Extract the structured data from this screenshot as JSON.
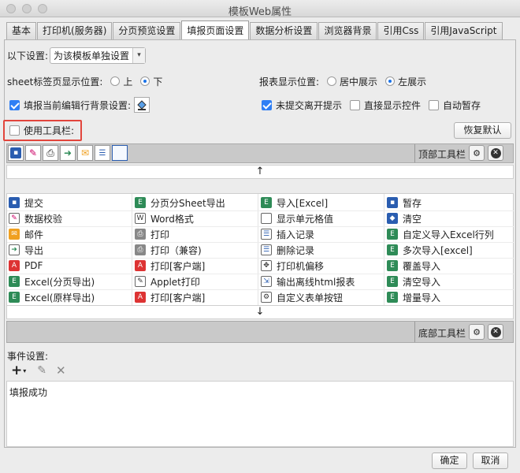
{
  "window": {
    "title": "模板Web属性"
  },
  "tabs": [
    "基本",
    "打印机(服务器)",
    "分页预览设置",
    "填报页面设置",
    "数据分析设置",
    "浏览器背景",
    "引用Css",
    "引用JavaScript"
  ],
  "settings": {
    "scope_label": "以下设置:",
    "scope_value": "为该模板单独设置",
    "sheet_pos_label": "sheet标签页显示位置:",
    "sheet_pos_top": "上",
    "sheet_pos_bottom": "下",
    "report_pos_label": "报表显示位置:",
    "report_pos_center": "居中展示",
    "report_pos_left": "左展示",
    "edit_bg_label": "填报当前编辑行背景设置:",
    "unsubmitted_label": "未提交离开提示",
    "direct_show_label": "直接显示控件",
    "auto_save_label": "自动暂存",
    "use_toolbar_label": "使用工具栏:",
    "restore_default": "恢复默认"
  },
  "toolbar": {
    "top_label": "顶部工具栏",
    "bottom_label": "底部工具栏",
    "up_arrow": "↑",
    "down_arrow": "↓"
  },
  "buttons": [
    [
      {
        "label": "提交",
        "icon": "save-icon"
      },
      {
        "label": "分页分Sheet导出",
        "icon": "excel-icon"
      },
      {
        "label": "导入[Excel]",
        "icon": "excel-icon"
      },
      {
        "label": "暂存",
        "icon": "save-icon"
      }
    ],
    [
      {
        "label": "数据校验",
        "icon": "verify-icon"
      },
      {
        "label": "Word格式",
        "icon": "word-icon"
      },
      {
        "label": "显示单元格值",
        "icon": "cell-icon"
      },
      {
        "label": "清空",
        "icon": "eraser-icon"
      }
    ],
    [
      {
        "label": "邮件",
        "icon": "mail-icon"
      },
      {
        "label": "打印",
        "icon": "printer-icon"
      },
      {
        "label": "插入记录",
        "icon": "insert-icon"
      },
      {
        "label": "自定义导入Excel行列",
        "icon": "excel-icon"
      }
    ],
    [
      {
        "label": "导出",
        "icon": "export-icon"
      },
      {
        "label": "打印（兼容)",
        "icon": "printer-icon"
      },
      {
        "label": "删除记录",
        "icon": "delete-record-icon"
      },
      {
        "label": "多次导入[excel]",
        "icon": "excel-icon"
      }
    ],
    [
      {
        "label": "PDF",
        "icon": "pdf-icon"
      },
      {
        "label": "打印[客户端]",
        "icon": "pdf-icon"
      },
      {
        "label": "打印机偏移",
        "icon": "move-icon"
      },
      {
        "label": "覆盖导入",
        "icon": "excel-icon"
      }
    ],
    [
      {
        "label": "Excel(分页导出)",
        "icon": "excel-icon"
      },
      {
        "label": "Applet打印",
        "icon": "applet-icon"
      },
      {
        "label": "输出离线html报表",
        "icon": "html-icon"
      },
      {
        "label": "清空导入",
        "icon": "excel-icon"
      }
    ],
    [
      {
        "label": "Excel(原样导出)",
        "icon": "excel-icon"
      },
      {
        "label": "打印[客户端]",
        "icon": "pdf-icon"
      },
      {
        "label": "自定义表单按钮",
        "icon": "gear-icon"
      },
      {
        "label": "增量导入",
        "icon": "excel-icon"
      }
    ]
  ],
  "events": {
    "label": "事件设置:",
    "items": [
      "填报成功"
    ]
  },
  "footer": {
    "ok": "确定",
    "cancel": "取消"
  }
}
